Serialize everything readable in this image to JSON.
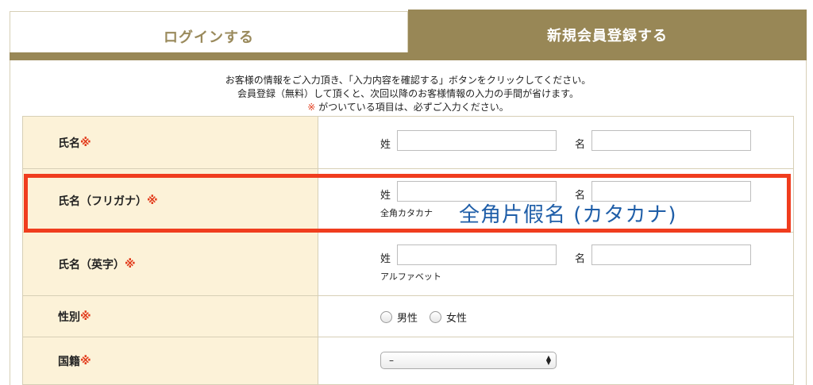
{
  "tabs": {
    "login": "ログインする",
    "register": "新規会員登録する"
  },
  "intro": {
    "line1": "お客様の情報をご入力頂き、「入力内容を確認する」ボタンをクリックしてください。",
    "line2": "会員登録（無料）して頂くと、次回以降のお客様情報の入力の手間が省けます。",
    "line3_mark": "※",
    "line3_text": " がついている項目は、必ずご入力ください。"
  },
  "required_mark": "※",
  "fields": {
    "name": {
      "label": "氏名",
      "last_label": "姓",
      "first_label": "名",
      "last_value": "",
      "first_value": ""
    },
    "kana": {
      "label": "氏名（フリガナ）",
      "last_label": "姓",
      "first_label": "名",
      "last_value": "",
      "first_value": "",
      "hint": "全角カタカナ"
    },
    "roman": {
      "label": "氏名（英字）",
      "last_label": "姓",
      "first_label": "名",
      "last_value": "",
      "first_value": "",
      "hint": "アルファベット"
    },
    "gender": {
      "label": "性別",
      "options": [
        "男性",
        "女性"
      ]
    },
    "nationality": {
      "label": "国籍",
      "selected": "–"
    }
  },
  "annotation": {
    "text": "全角片假名 (カタカナ)",
    "color": "#1f5ea8",
    "highlight_color": "#f03d1e"
  },
  "colors": {
    "accent": "#988756",
    "label_bg": "#fcf2d8",
    "required": "#e23c1c"
  }
}
